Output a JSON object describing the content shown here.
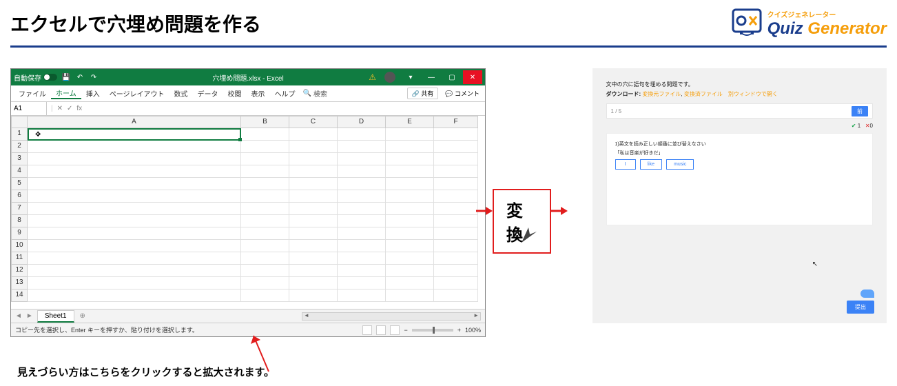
{
  "header": {
    "title": "エクセルで穴埋め問題を作る",
    "logo_kana": "クイズジェネレーター",
    "logo_quiz": "Quiz ",
    "logo_gen": "Generator"
  },
  "excel": {
    "autosave_label": "自動保存",
    "filename": "穴埋め問題.xlsx - Excel",
    "tabs": {
      "file": "ファイル",
      "home": "ホーム",
      "insert": "挿入",
      "layout": "ページレイアウト",
      "formula": "数式",
      "data": "データ",
      "review": "校閲",
      "view": "表示",
      "help": "ヘルプ"
    },
    "search": "検索",
    "share": "共有",
    "comment": "コメント",
    "namebox": "A1",
    "fx": "fx",
    "cols": {
      "A": "A",
      "B": "B",
      "C": "C",
      "D": "D",
      "E": "E",
      "F": "F"
    },
    "rows": [
      "1",
      "2",
      "3",
      "4",
      "5",
      "6",
      "7",
      "8",
      "9",
      "10",
      "11",
      "12",
      "13",
      "14"
    ],
    "sheet": "Sheet1",
    "status": "コピー先を選択し、Enter キーを押すか、貼り付けを選択します。",
    "zoom": "100%"
  },
  "convert": {
    "label": "変換"
  },
  "quiz": {
    "desc": "文中の穴に語句を埋める問題です。",
    "dl_label": "ダウンロード: ",
    "dl_link1": "変換元ファイル",
    "dl_sep": ", ",
    "dl_link2": "変換済ファイル",
    "dl_newwin": "　別ウィンドウで開く",
    "progress": "1 / 5",
    "prog_btn": "前",
    "score_ok": "1",
    "score_x": "0",
    "q_text": "1)英文を読み正しい順番に並び替えなさい",
    "q_sub": "「私は音楽が好きだ」",
    "slots": [
      "I",
      "like",
      "music"
    ],
    "submit": "提出"
  },
  "caption": "見えづらい方はこちらをクリックすると拡大されます。"
}
